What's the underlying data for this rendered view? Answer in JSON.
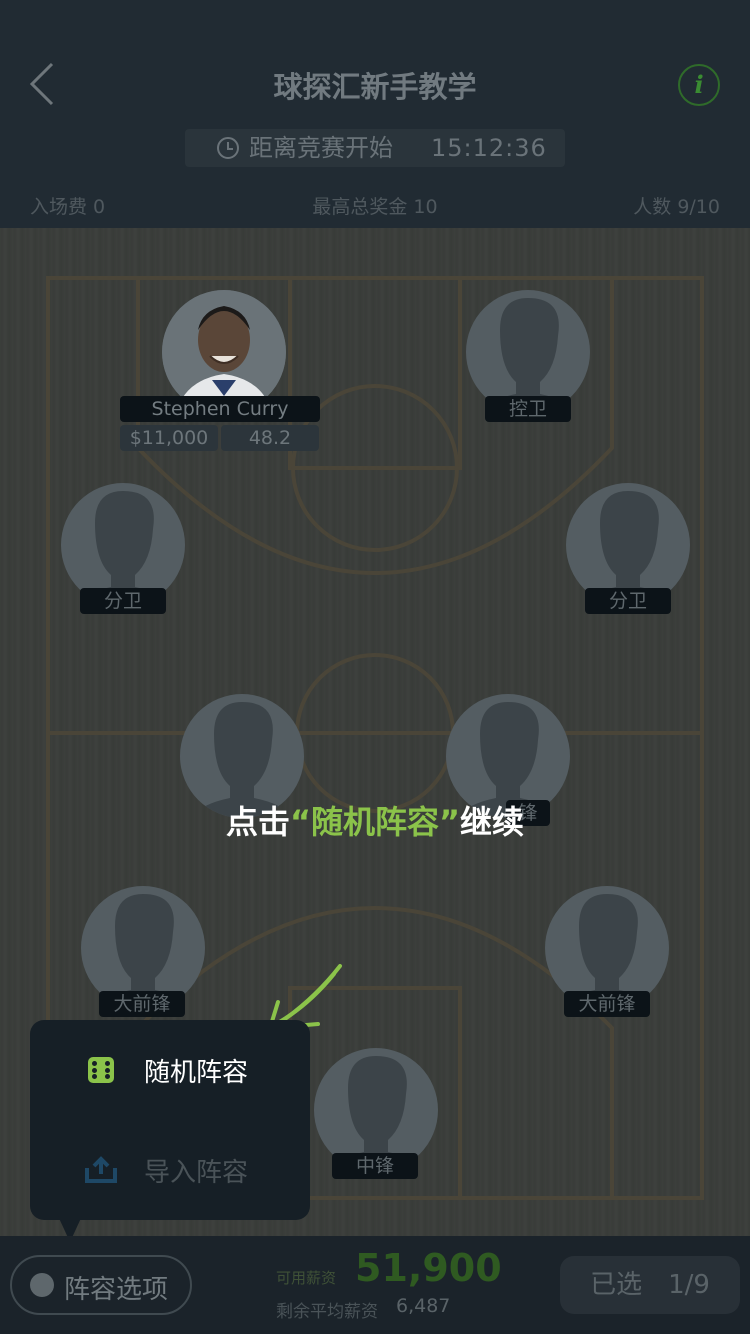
{
  "header": {
    "title": "球探汇新手教学",
    "info_icon_glyph": "i",
    "countdown_label": "距离竞赛开始",
    "countdown_time": "15:12:36",
    "entry_fee": "入场费 0",
    "top_prize": "最高总奖金 10",
    "participants": "人数 9/10"
  },
  "court": {
    "filled_player": {
      "name": "Stephen Curry",
      "salary": "$11,000",
      "score": "48.2"
    },
    "slots": [
      {
        "tag": "控卫"
      },
      {
        "tag": "分卫"
      },
      {
        "tag": "分卫"
      },
      {
        "tag": "锋"
      },
      {
        "tag": "大前锋"
      },
      {
        "tag": "大前锋"
      },
      {
        "tag": "中锋"
      }
    ]
  },
  "instruction": {
    "prefix": "点击",
    "highlight": "“随机阵容”",
    "suffix": "继续"
  },
  "popup": {
    "items": [
      {
        "label": "随机阵容",
        "icon": "dice-icon"
      },
      {
        "label": "导入阵容",
        "icon": "upload-icon"
      }
    ]
  },
  "bottom": {
    "lineup_button": "阵容选项",
    "salary_label": "可用薪资",
    "salary_value": "51,900",
    "avg_label": "剩余平均薪资",
    "avg_value": "6,487",
    "selected": "已选　1/9"
  },
  "colors": {
    "accent": "#8bc34a",
    "overlay": "#1b242b"
  }
}
